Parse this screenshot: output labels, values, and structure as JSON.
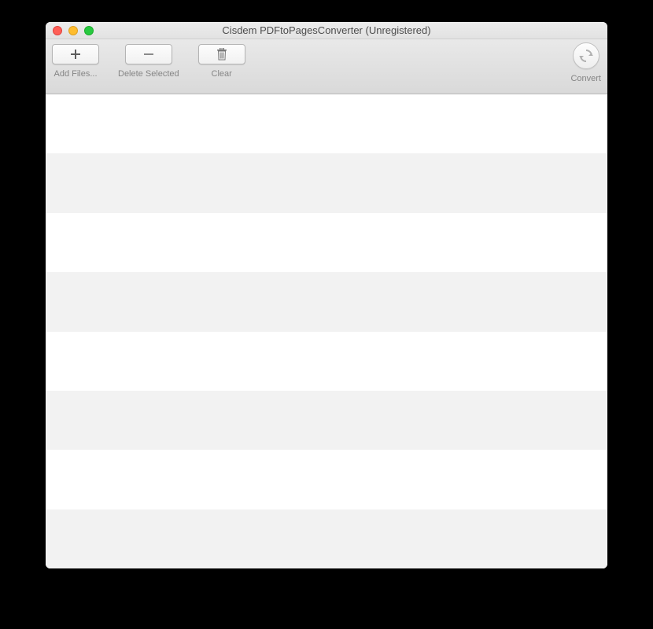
{
  "window": {
    "title": "Cisdem PDFtoPagesConverter (Unregistered)"
  },
  "toolbar": {
    "add_label": "Add Files...",
    "delete_label": "Delete Selected",
    "clear_label": "Clear",
    "convert_label": "Convert"
  }
}
